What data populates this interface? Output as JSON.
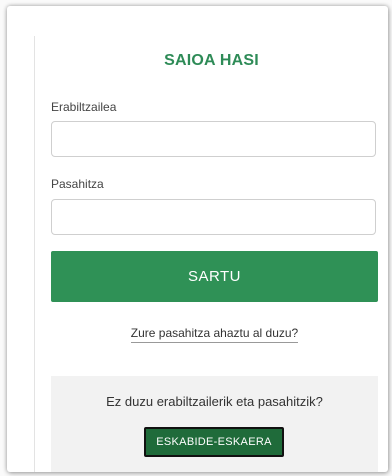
{
  "login": {
    "title": "SAIOA HASI",
    "username_label": "Erabiltzailea",
    "username_value": "",
    "username_placeholder": "",
    "password_label": "Pasahitza",
    "password_value": "",
    "password_placeholder": "",
    "submit_label": "SARTU",
    "forgot_link": "Zure pasahitza ahaztu al duzu?"
  },
  "signup": {
    "prompt": "Ez duzu erabiltzailerik eta pasahitzik?",
    "button_label": "ESKABIDE-ESKAERA"
  },
  "colors": {
    "accent_green": "#2f9156",
    "title_green": "#2e8b57",
    "signup_button": "#1f6b3a",
    "panel_background": "#f2f2f2"
  }
}
